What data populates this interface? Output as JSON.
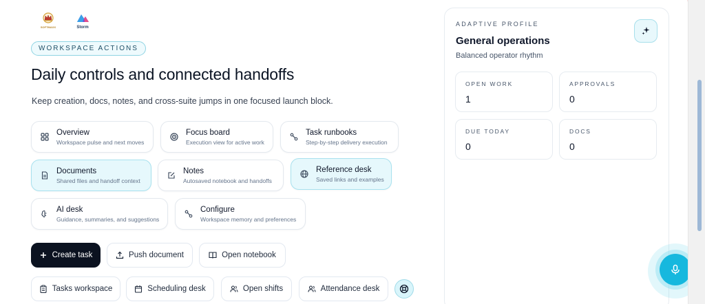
{
  "brands": [
    {
      "label": "SOFTMAXX",
      "icon": "crown-logo-icon"
    },
    {
      "label": "Storm",
      "icon": "storm-cloud-logo-icon"
    }
  ],
  "header": {
    "chip": "WORKSPACE ACTIONS",
    "title": "Daily controls and connected handoffs",
    "subtitle": "Keep creation, docs, notes, and cross-suite jumps in one focused launch block."
  },
  "tiles": [
    {
      "title": "Overview",
      "desc": "Workspace pulse and next moves",
      "icon": "grid-icon"
    },
    {
      "title": "Focus board",
      "desc": "Execution view for active work",
      "icon": "target-icon"
    },
    {
      "title": "Task runbooks",
      "desc": "Step-by-step delivery execution",
      "icon": "route-icon"
    },
    {
      "title": "Documents",
      "desc": "Shared files and handoff context",
      "icon": "document-icon"
    },
    {
      "title": "Notes",
      "desc": "Autosaved notebook and handoffs",
      "icon": "edit-note-icon"
    },
    {
      "title": "Reference desk",
      "desc": "Saved links and examples",
      "icon": "globe-icon"
    },
    {
      "title": "AI desk",
      "desc": "Guidance, summaries, and suggestions",
      "icon": "brain-icon"
    },
    {
      "title": "Configure",
      "desc": "Workspace memory and preferences",
      "icon": "route-icon"
    }
  ],
  "actions": {
    "create_task": "Create task",
    "push_document": "Push document",
    "open_notebook": "Open notebook"
  },
  "desks": {
    "tasks": "Tasks workspace",
    "scheduling": "Scheduling desk",
    "shifts": "Open shifts",
    "attendance": "Attendance desk"
  },
  "profile": {
    "eyebrow": "ADAPTIVE PROFILE",
    "title": "General operations",
    "subtitle": "Balanced operator rhythm",
    "stats": [
      {
        "label": "OPEN WORK",
        "value": "1"
      },
      {
        "label": "APPROVALS",
        "value": "0"
      },
      {
        "label": "DUE TODAY",
        "value": "0"
      },
      {
        "label": "DOCS",
        "value": "0"
      }
    ]
  },
  "colors": {
    "accent": "#16b8de",
    "primary_dark": "#0b1220",
    "active_tile": "#e6f8fc"
  }
}
